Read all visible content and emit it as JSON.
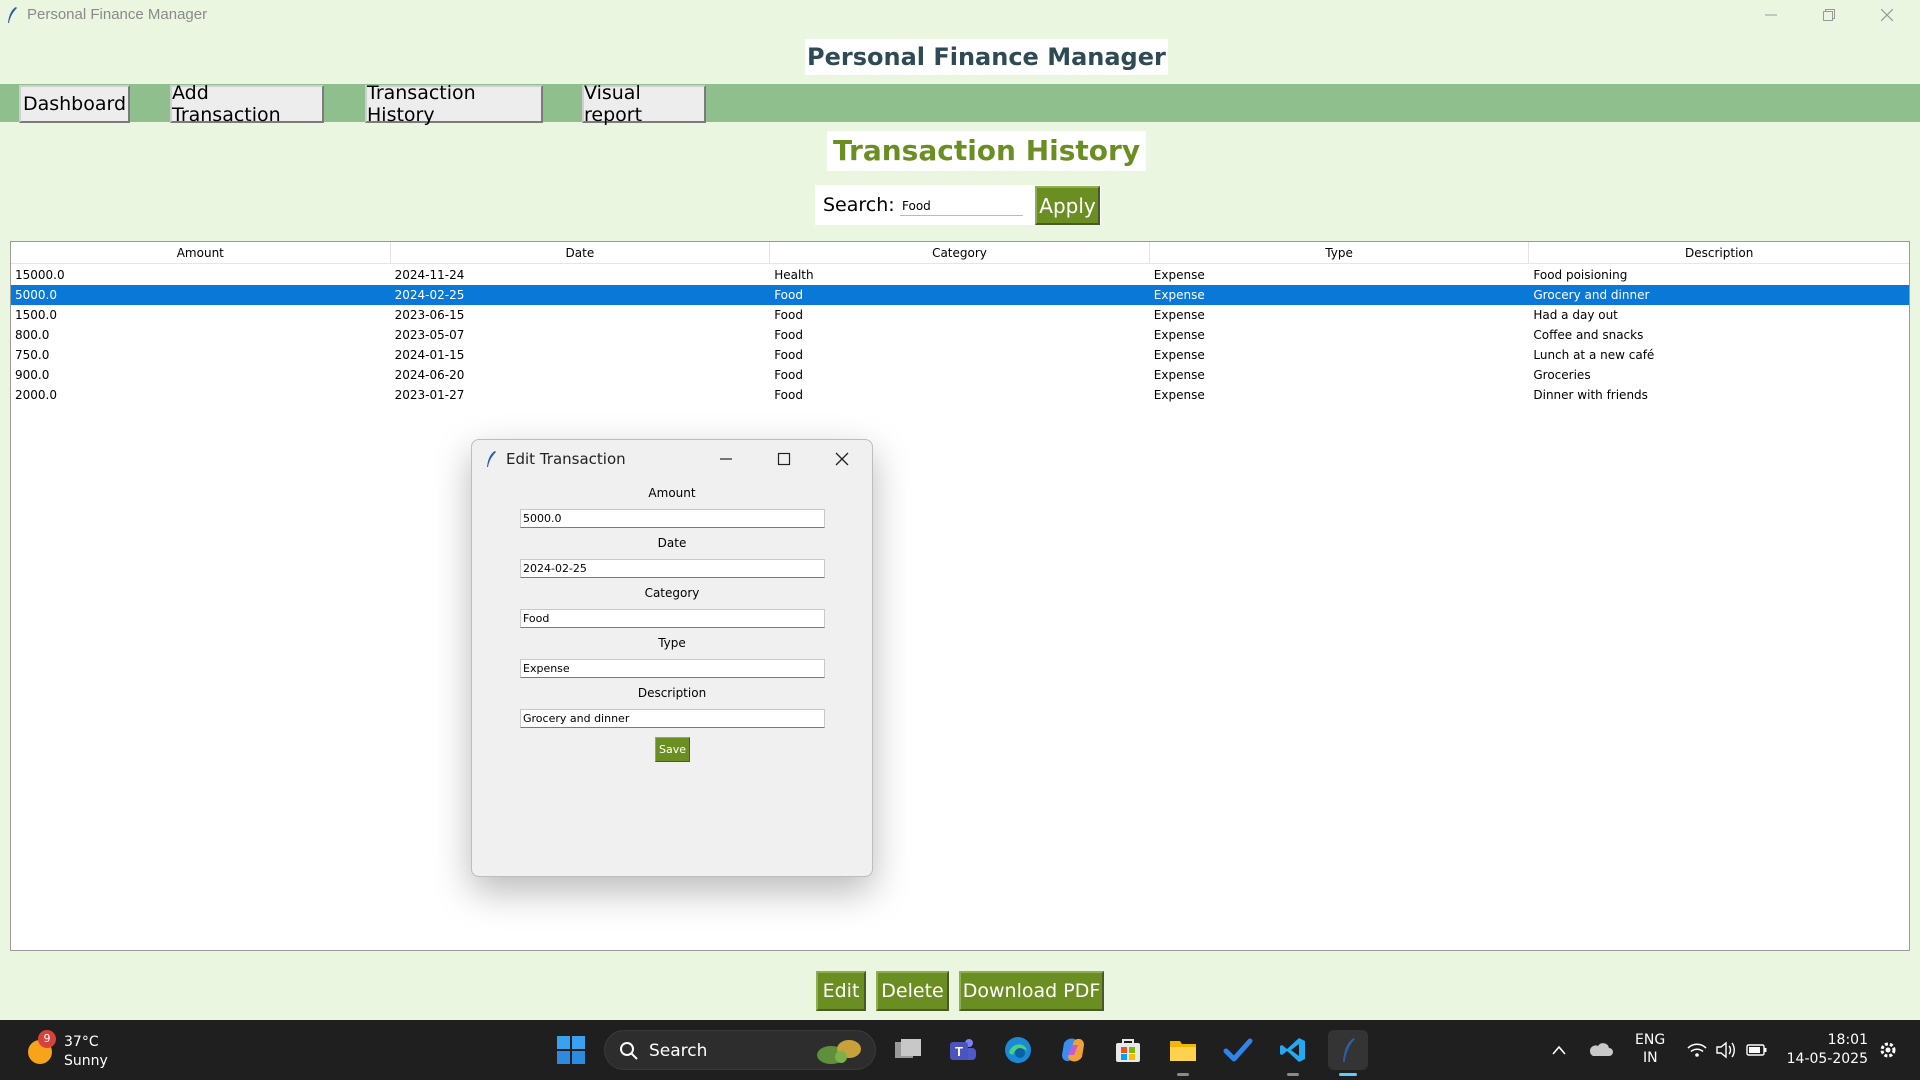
{
  "window": {
    "title": "Personal Finance Manager"
  },
  "app": {
    "heading": "Personal Finance Manager"
  },
  "nav": {
    "tabs": [
      "Dashboard",
      "Add Transaction",
      "Transaction History",
      "Visual report"
    ]
  },
  "page": {
    "title": "Transaction History"
  },
  "search": {
    "label": "Search:",
    "value": "Food",
    "apply_label": "Apply"
  },
  "table": {
    "columns": [
      "Amount",
      "Date",
      "Category",
      "Type",
      "Description"
    ],
    "rows": [
      {
        "amount": "15000.0",
        "date": "2024-11-24",
        "category": "Health",
        "type": "Expense",
        "description": "Food poisioning",
        "selected": false
      },
      {
        "amount": "5000.0",
        "date": "2024-02-25",
        "category": "Food",
        "type": "Expense",
        "description": "Grocery and dinner",
        "selected": true
      },
      {
        "amount": "1500.0",
        "date": "2023-06-15",
        "category": "Food",
        "type": "Expense",
        "description": "Had a day out",
        "selected": false
      },
      {
        "amount": "800.0",
        "date": "2023-05-07",
        "category": "Food",
        "type": "Expense",
        "description": "Coffee and snacks",
        "selected": false
      },
      {
        "amount": "750.0",
        "date": "2024-01-15",
        "category": "Food",
        "type": "Expense",
        "description": "Lunch at a new café",
        "selected": false
      },
      {
        "amount": "900.0",
        "date": "2024-06-20",
        "category": "Food",
        "type": "Expense",
        "description": "Groceries",
        "selected": false
      },
      {
        "amount": "2000.0",
        "date": "2023-01-27",
        "category": "Food",
        "type": "Expense",
        "description": "Dinner with friends",
        "selected": false
      }
    ]
  },
  "dialog": {
    "title": "Edit Transaction",
    "fields": [
      {
        "label": "Amount",
        "value": "5000.0"
      },
      {
        "label": "Date",
        "value": "2024-02-25"
      },
      {
        "label": "Category",
        "value": "Food"
      },
      {
        "label": "Type",
        "value": "Expense"
      },
      {
        "label": "Description",
        "value": "Grocery and dinner"
      }
    ],
    "save_label": "Save"
  },
  "actions": {
    "edit": "Edit",
    "delete": "Delete",
    "download": "Download PDF"
  },
  "taskbar": {
    "weather": {
      "temp": "37°C",
      "condition": "Sunny",
      "badge": "9"
    },
    "search_label": "Search",
    "language": {
      "line1": "ENG",
      "line2": "IN"
    },
    "time": "18:01",
    "date": "14-05-2025"
  },
  "colors": {
    "accent_green": "#6b8e23",
    "nav_green": "#8fbf8c",
    "background": "#eaf6e0",
    "selection": "#0a78d7"
  }
}
